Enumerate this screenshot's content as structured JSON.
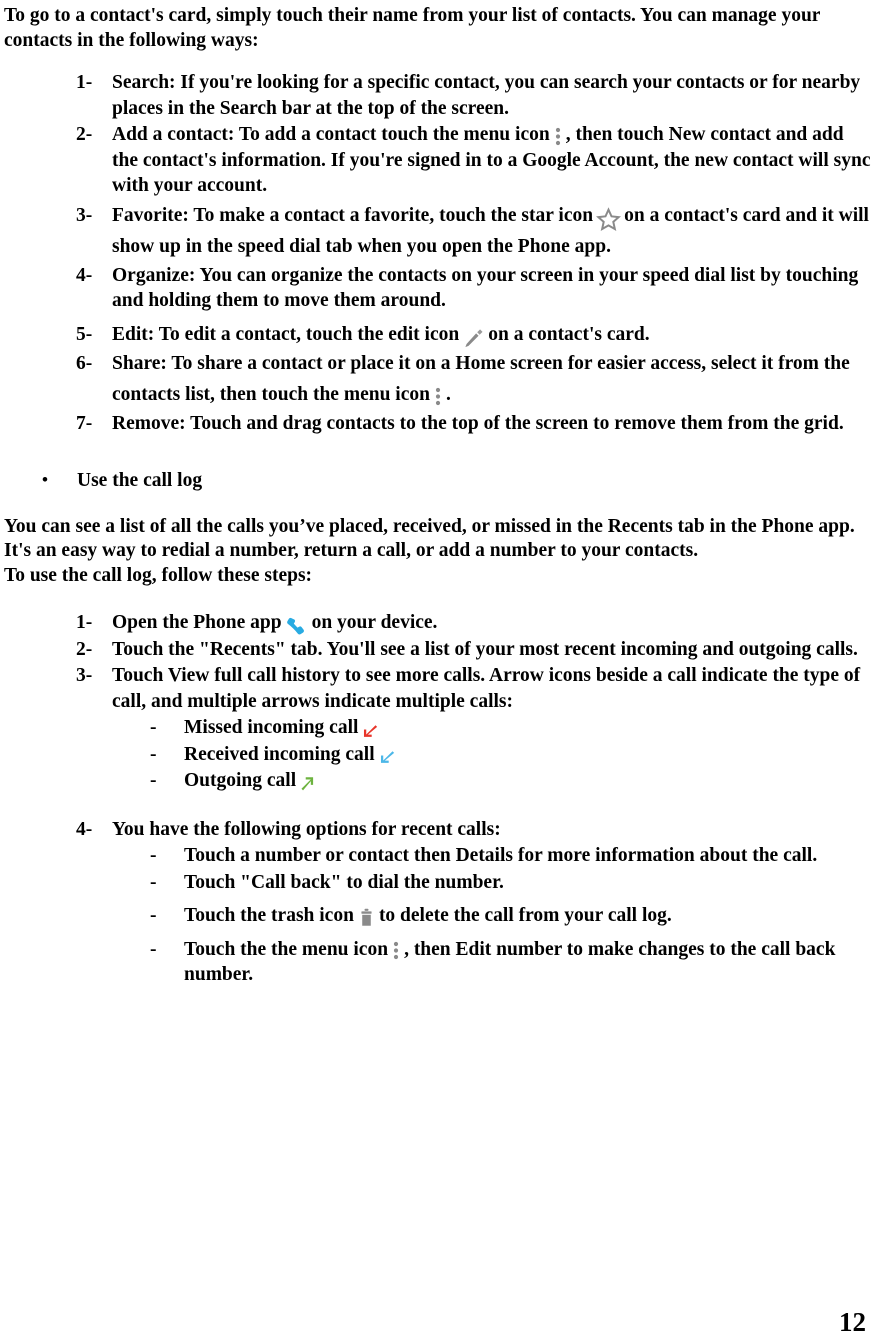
{
  "document": {
    "page_number": "12"
  },
  "intro": {
    "text": "To go to a contact's card, simply touch their name from your list of contacts. You can manage your contacts in the following ways:"
  },
  "contacts_list": {
    "items": [
      {
        "marker": "1-",
        "text_before": "Search: If you're looking for a specific contact, you can search your contacts or for nearby places in the Search bar at the top of the screen.",
        "icon": null,
        "text_after": ""
      },
      {
        "marker": "2-",
        "text_before": "Add a contact: To add a contact touch the menu icon",
        "icon": "menu-icon",
        "text_after": ", then touch New contact and add the contact's information. If you're signed in to a Google Account, the new contact will sync with your account."
      },
      {
        "marker": "3-",
        "text_before": "Favorite: To make a contact a favorite, touch the star icon",
        "icon": "star-icon",
        "text_after": "on a contact's card and it will show up in the speed dial tab when you open the Phone app."
      },
      {
        "marker": "4-",
        "text_before": "Organize: You can organize the contacts on your screen in your speed dial list by touching and holding them to move them around.",
        "icon": null,
        "text_after": ""
      },
      {
        "marker": "5-",
        "text_before": "Edit: To edit a contact, touch the edit icon",
        "icon": "pencil-icon",
        "text_after": "on a contact's card."
      },
      {
        "marker": "6-",
        "text_before": "Share: To share a contact or place it on a Home screen for easier access, select it from the contacts list, then touch the menu icon",
        "icon": "menu-icon",
        "text_after": "."
      },
      {
        "marker": "7-",
        "text_before": "Remove: Touch and drag contacts to the top of the screen to remove them from the grid.",
        "icon": null,
        "text_after": ""
      }
    ]
  },
  "call_log_heading": {
    "bullet": "•",
    "text": "Use the call log"
  },
  "call_log_intro": {
    "paragraph": "You can see a list of all the calls you’ve placed, received, or missed in the Recents tab in the Phone app. It's an easy way to redial a number, return a call, or add a number to your contacts.",
    "steps_lead": "To use the call log, follow these steps:"
  },
  "call_log_steps": {
    "items": [
      {
        "marker": "1-",
        "text_before": "Open the Phone app",
        "icon": "phone-icon",
        "text_after": "on your device."
      },
      {
        "marker": "2-",
        "text_before": "Touch the \"Recents\" tab. You'll see a list of your most recent incoming and outgoing calls.",
        "icon": null,
        "text_after": ""
      },
      {
        "marker": "3-",
        "text_before": "Touch View full call history to see more calls. Arrow icons beside a call indicate the type of call, and multiple arrows indicate multiple calls:",
        "icon": null,
        "text_after": ""
      }
    ],
    "call_types": [
      {
        "marker": "-",
        "text_before": "Missed incoming call",
        "icon": "arrow-down-left-icon",
        "icon_color": "#e8352a",
        "text_after": ""
      },
      {
        "marker": "-",
        "text_before": "Received incoming call",
        "icon": "arrow-down-left-icon",
        "icon_color": "#4cb7e8",
        "text_after": ""
      },
      {
        "marker": "-",
        "text_before": "Outgoing call",
        "icon": "arrow-up-right-icon",
        "icon_color": "#6db33f",
        "text_after": ""
      }
    ],
    "options_item": {
      "marker": "4-",
      "text": "You have the following options for recent calls:"
    },
    "options": [
      {
        "marker": "-",
        "text_before": "Touch a number or contact then Details for more information about the call.",
        "icon": null,
        "text_after": ""
      },
      {
        "marker": "-",
        "text_before": "Touch \"Call back\" to dial the number.",
        "icon": null,
        "text_after": ""
      },
      {
        "marker": "-",
        "text_before": "Touch the trash icon",
        "icon": "trash-icon",
        "text_after": "to delete the call from your call log."
      },
      {
        "marker": "-",
        "text_before": "Touch the the menu icon",
        "icon": "menu-icon",
        "text_after": ", then Edit number to make changes to the call back number."
      }
    ]
  },
  "colors": {
    "icon_gray": "#8a8a8a",
    "phone_blue": "#29ABE2",
    "missed_red": "#e8352a",
    "received_blue": "#4cb7e8",
    "outgoing_green": "#6db33f",
    "text": "#000000",
    "background": "#ffffff"
  }
}
